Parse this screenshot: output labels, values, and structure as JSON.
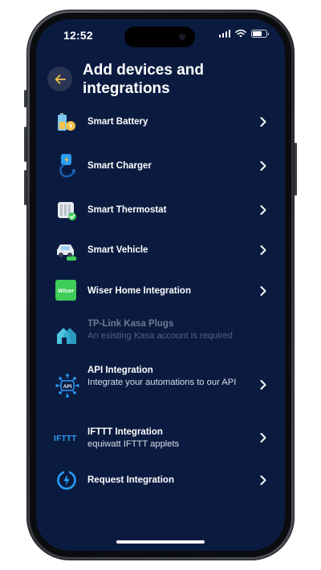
{
  "status_bar": {
    "time": "12:52"
  },
  "header": {
    "title": "Add devices and integrations"
  },
  "items": [
    {
      "label": "Smart Battery",
      "sub": "",
      "icon": "battery-icon",
      "enabled": true
    },
    {
      "label": "Smart Charger",
      "sub": "",
      "icon": "ev-charger-icon",
      "enabled": true
    },
    {
      "label": "Smart Thermostat",
      "sub": "",
      "icon": "thermostat-icon",
      "enabled": true
    },
    {
      "label": "Smart Vehicle",
      "sub": "",
      "icon": "vehicle-icon",
      "enabled": true
    },
    {
      "label": "Wiser Home Integration",
      "sub": "",
      "icon": "wiser-icon",
      "enabled": true
    },
    {
      "label": "TP-Link Kasa Plugs",
      "sub": "An existing Kasa account is required",
      "icon": "kasa-icon",
      "enabled": false
    },
    {
      "label": "API Integration",
      "sub": "Integrate your automations to our API",
      "icon": "api-icon",
      "enabled": true
    },
    {
      "label": "IFTTT Integration",
      "sub": "equiwatt IFTTT applets",
      "icon": "ifttt-icon",
      "enabled": true
    },
    {
      "label": "Request Integration",
      "sub": "",
      "icon": "request-integration-icon",
      "enabled": true
    }
  ],
  "icon_text": {
    "wiser_logo": "Wiser",
    "api_chip": "API",
    "ifttt_logo": "IFTTT"
  },
  "colors": {
    "background": "#0b1b40",
    "accent": "#f6c04a",
    "wiser_green": "#3dcd58",
    "blue": "#2a9df4"
  }
}
